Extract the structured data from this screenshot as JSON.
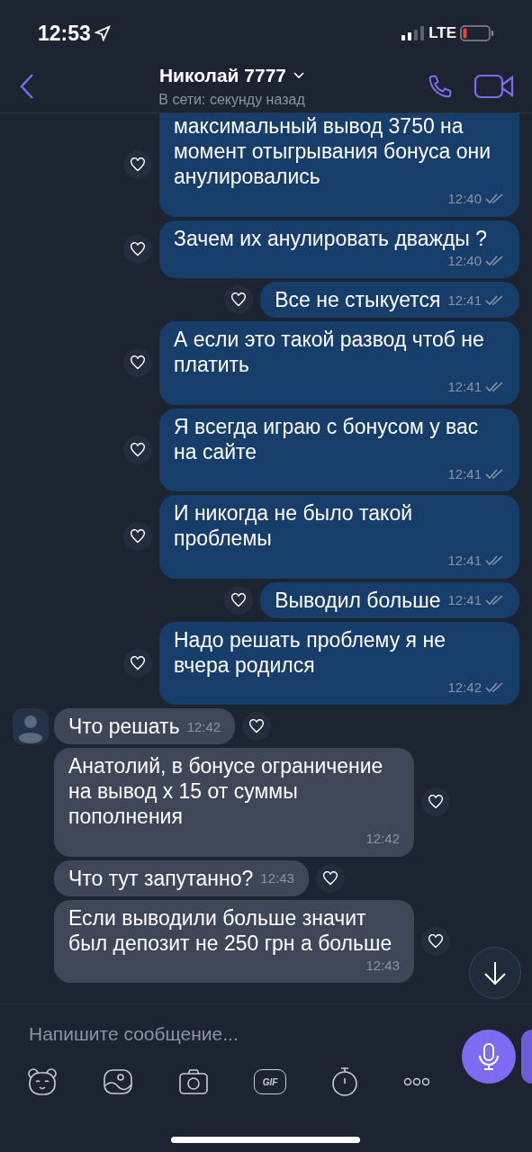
{
  "status_bar": {
    "time": "12:53",
    "network": "LTE"
  },
  "header": {
    "title": "Николай 7777",
    "subtitle": "В сети: секунду назад"
  },
  "messages": [
    {
      "kind": "outgoing",
      "text": "максимальный вывод 3750 на момент отыгрывания бонуса они анулировались",
      "time": "12:40"
    },
    {
      "kind": "outgoing",
      "text": "Зачем их анулировать дважды ?",
      "time": "12:40"
    },
    {
      "kind": "outgoing",
      "text": "Все не стыкуется",
      "time": "12:41"
    },
    {
      "kind": "outgoing",
      "text": "А если это такой развод чтоб не платить",
      "time": "12:41"
    },
    {
      "kind": "outgoing",
      "text": "Я всегда играю с бонусом у вас на сайте",
      "time": "12:41"
    },
    {
      "kind": "outgoing",
      "text": "И никогда не было такой проблемы",
      "time": "12:41"
    },
    {
      "kind": "outgoing",
      "text": "Выводил больше",
      "time": "12:41"
    },
    {
      "kind": "outgoing",
      "text": "Надо решать проблему я не вчера родился",
      "time": "12:42"
    },
    {
      "kind": "incoming",
      "text": "Что решать",
      "time": "12:42"
    },
    {
      "kind": "incoming",
      "text": "Анатолий, в бонусе ограничение на вывод х 15 от суммы пополнения",
      "time": "12:42"
    },
    {
      "kind": "incoming",
      "text": "Что тут запутанно?",
      "time": "12:43"
    },
    {
      "kind": "incoming",
      "text": "Если выводили больше значит был депозит не 250 грн а больше",
      "time": "12:43"
    }
  ],
  "composer": {
    "placeholder": "Напишите сообщение...",
    "gif_label": "GIF"
  }
}
